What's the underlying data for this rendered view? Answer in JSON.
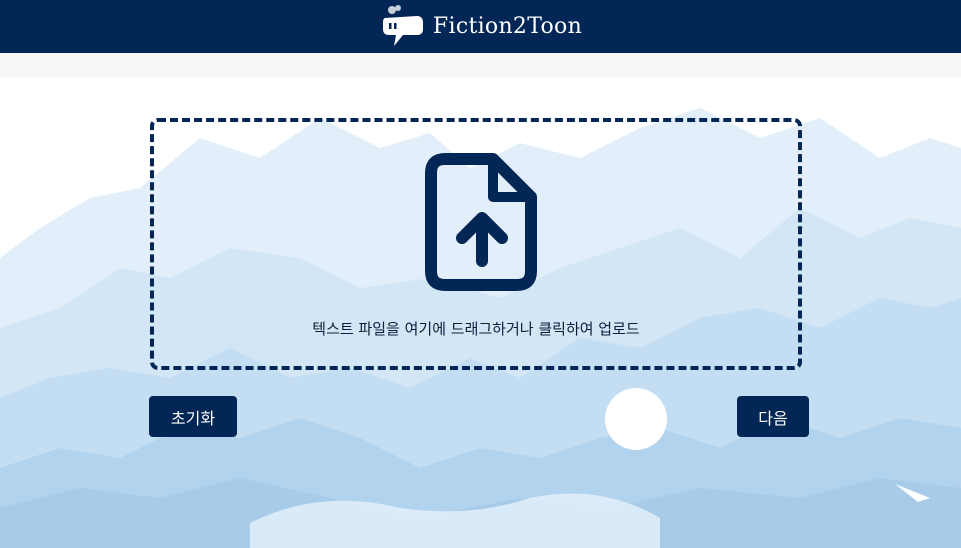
{
  "header": {
    "brand_name": "Fiction2Toon",
    "background_color": "#022655"
  },
  "upload": {
    "icon": "file-upload-icon",
    "prompt": "텍스트 파일을 여기에 드래그하거나 클릭하여 업로드",
    "border_color": "#022655"
  },
  "actions": {
    "reset_label": "초기화",
    "next_label": "다음"
  },
  "background": {
    "scene": "sky-clouds-illustration",
    "colors": [
      "#dfeefa",
      "#c3ddf2",
      "#a9cde9",
      "#ffffff"
    ]
  }
}
